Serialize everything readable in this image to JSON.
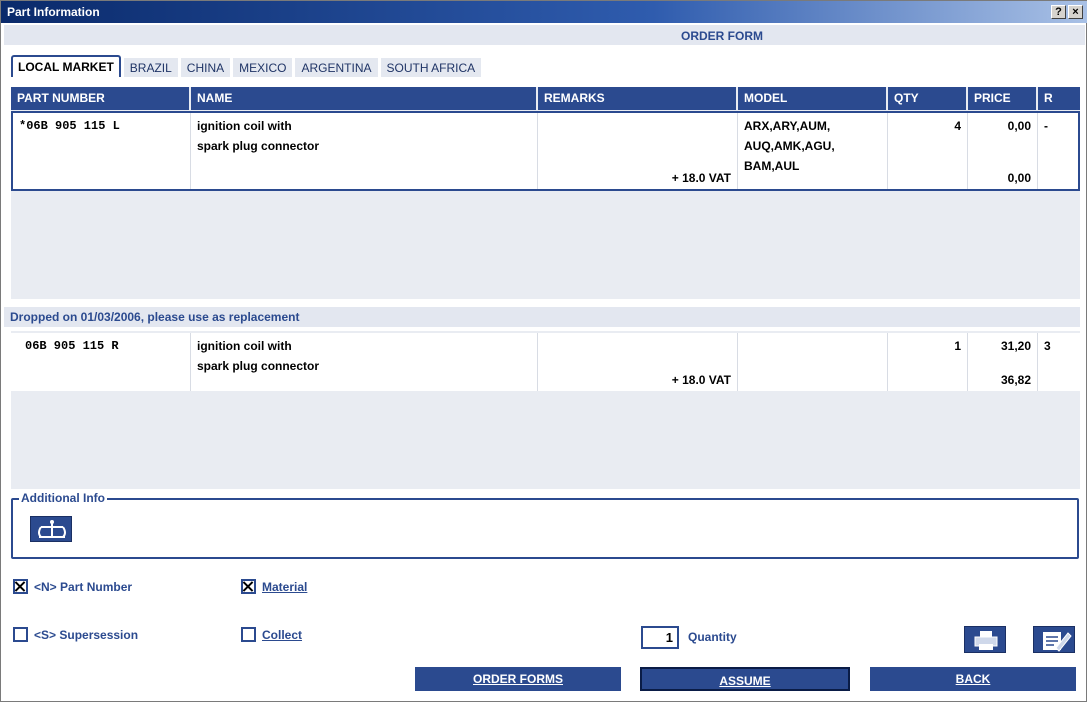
{
  "window": {
    "title": "Part Information",
    "help_label": "?",
    "close_label": "×"
  },
  "form_header": "ORDER FORM",
  "tabs": [
    "LOCAL MARKET",
    "BRAZIL",
    "CHINA",
    "MEXICO",
    "ARGENTINA",
    "SOUTH AFRICA"
  ],
  "active_tab": "LOCAL MARKET",
  "columns": [
    "PART NUMBER",
    "NAME",
    "REMARKS",
    "MODEL",
    "QTY",
    "PRICE",
    "R"
  ],
  "main_part": {
    "part_number": "*06B 905 115 L",
    "name_line1": "ignition coil with",
    "name_line2": "spark plug connector",
    "remarks": "+ 18.0 VAT",
    "model_line1": "ARX,ARY,AUM,",
    "model_line2": "AUQ,AMK,AGU,",
    "model_line3": "BAM,AUL",
    "qty": "4",
    "price": "0,00",
    "price_gross": "0,00",
    "r": "-"
  },
  "dropped_notice": "Dropped on 01/03/2006, please use as replacement",
  "replacement_part": {
    "part_number": "06B 905 115 R",
    "name_line1": "ignition coil with",
    "name_line2": "spark plug connector",
    "remarks": "+ 18.0 VAT",
    "qty": "1",
    "price": "31,20",
    "price_gross": "36,82",
    "r": "3"
  },
  "additional_info": {
    "label": "Additional Info",
    "icon": "scale-icon"
  },
  "options": {
    "part_number": {
      "label": "<N> Part Number",
      "checked": true
    },
    "material": {
      "label": "Material",
      "checked": true
    },
    "supersession": {
      "label": "<S> Supersession",
      "checked": false
    },
    "collect": {
      "label": "Collect",
      "checked": false
    }
  },
  "quantity": {
    "value": "1",
    "label": "Quantity"
  },
  "icons": {
    "print": "printer-icon",
    "edit": "notepad-edit-icon"
  },
  "buttons": {
    "order_forms": "ORDER FORMS",
    "assume": "ASSUME",
    "back": "BACK"
  },
  "colors": {
    "accent": "#2b4a8f",
    "panel": "#e9ecf2",
    "header_band": "#e3e7f0"
  }
}
